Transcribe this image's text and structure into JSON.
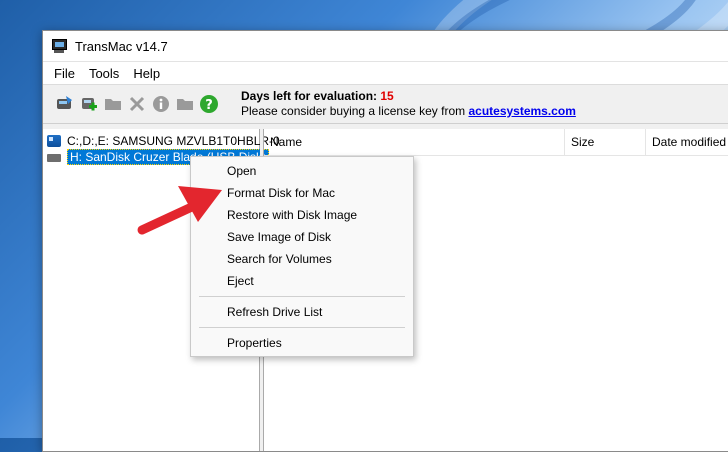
{
  "window": {
    "title": "TransMac v14.7"
  },
  "menu": [
    "File",
    "Tools",
    "Help"
  ],
  "toolbar": {
    "icons": [
      "image-to-disk-icon",
      "add-disk-icon",
      "folder-icon",
      "delete-icon",
      "info-icon",
      "folder-icon",
      "help-icon"
    ],
    "eval_label": "Days left for evaluation:",
    "eval_days": "15",
    "license_text": "Please consider buying a license key from",
    "license_link": "acutesystems.com"
  },
  "tree": {
    "items": [
      {
        "label": "C:,D:,E:  SAMSUNG MZVLB1T0HBLR-0",
        "icon": "hard-drive-icon"
      },
      {
        "label": "H: SanDisk Cruzer Blade (USB Disk)",
        "icon": "usb-drive-icon"
      }
    ]
  },
  "list": {
    "columns": [
      "Name",
      "Size",
      "Date modified"
    ]
  },
  "context_menu": {
    "items": [
      "Open",
      "Format Disk for Mac",
      "Restore with Disk Image",
      "Save Image of Disk",
      "Search for Volumes",
      "Eject",
      "Refresh Drive List",
      "Properties"
    ]
  },
  "colors": {
    "accent": "#0078d7",
    "days_red": "#e00000",
    "link_blue": "#0000ee",
    "arrow_red": "#e3262e"
  }
}
